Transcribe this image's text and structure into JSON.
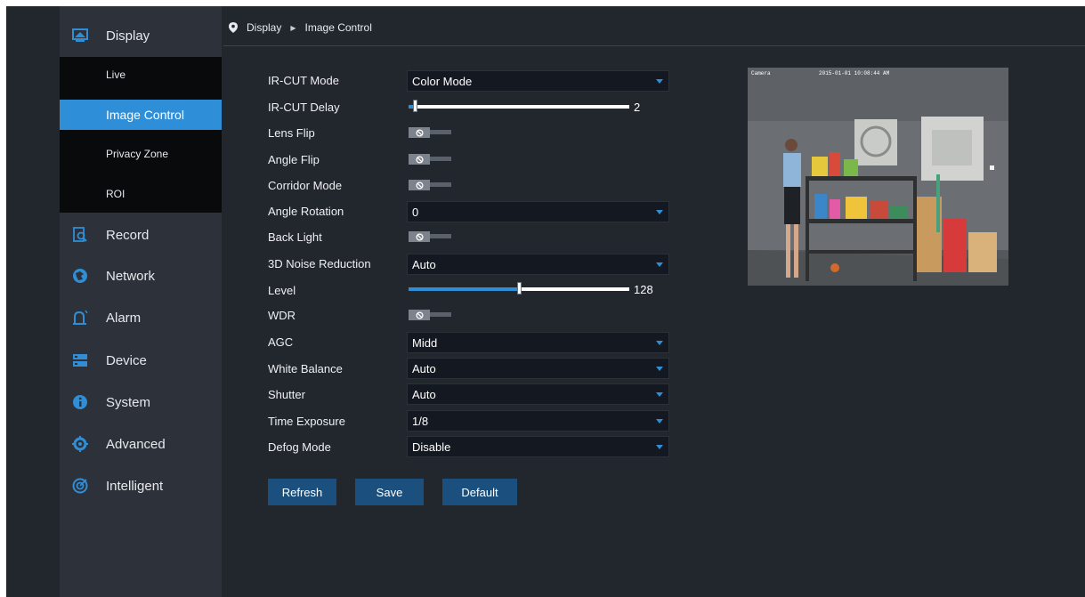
{
  "sidebar": {
    "items": [
      {
        "label": "Display",
        "icon": "monitor-icon"
      },
      {
        "label": "Record",
        "icon": "record-icon"
      },
      {
        "label": "Network",
        "icon": "network-icon"
      },
      {
        "label": "Alarm",
        "icon": "alarm-icon"
      },
      {
        "label": "Device",
        "icon": "device-icon"
      },
      {
        "label": "System",
        "icon": "info-icon"
      },
      {
        "label": "Advanced",
        "icon": "gear-icon"
      },
      {
        "label": "Intelligent",
        "icon": "intelligent-icon"
      }
    ],
    "submenu": [
      {
        "label": "Live"
      },
      {
        "label": "Image Control",
        "active": true
      },
      {
        "label": "Privacy Zone"
      },
      {
        "label": "ROI"
      }
    ]
  },
  "breadcrumb": {
    "parent": "Display",
    "current": "Image Control"
  },
  "form": {
    "ir_cut_mode": {
      "label": "IR-CUT Mode",
      "value": "Color Mode"
    },
    "ir_cut_delay": {
      "label": "IR-CUT Delay",
      "value": "2",
      "fraction": 0.03
    },
    "lens_flip": {
      "label": "Lens Flip",
      "on": false
    },
    "angle_flip": {
      "label": "Angle Flip",
      "on": false
    },
    "corridor_mode": {
      "label": "Corridor Mode",
      "on": false
    },
    "angle_rotation": {
      "label": "Angle Rotation",
      "value": "0"
    },
    "back_light": {
      "label": "Back Light",
      "on": false
    },
    "noise_reduction": {
      "label": "3D Noise Reduction",
      "value": "Auto"
    },
    "level": {
      "label": "Level",
      "value": "128",
      "fraction": 0.5
    },
    "wdr": {
      "label": "WDR",
      "on": false
    },
    "agc": {
      "label": "AGC",
      "value": "Midd"
    },
    "white_balance": {
      "label": "White Balance",
      "value": "Auto"
    },
    "shutter": {
      "label": "Shutter",
      "value": "Auto"
    },
    "time_exposure": {
      "label": "Time Exposure",
      "value": "1/8"
    },
    "defog_mode": {
      "label": "Defog Mode",
      "value": "Disable"
    }
  },
  "buttons": {
    "refresh": "Refresh",
    "save": "Save",
    "default": "Default"
  },
  "preview": {
    "camera_label": "Camera",
    "timestamp": "2015-01-01 10:08:44 AM"
  },
  "colors": {
    "accent": "#2e8fd8",
    "background": "#22262d",
    "sidebar": "#2d323a",
    "submenu": "#090a0c",
    "button": "#1b4f7e"
  }
}
